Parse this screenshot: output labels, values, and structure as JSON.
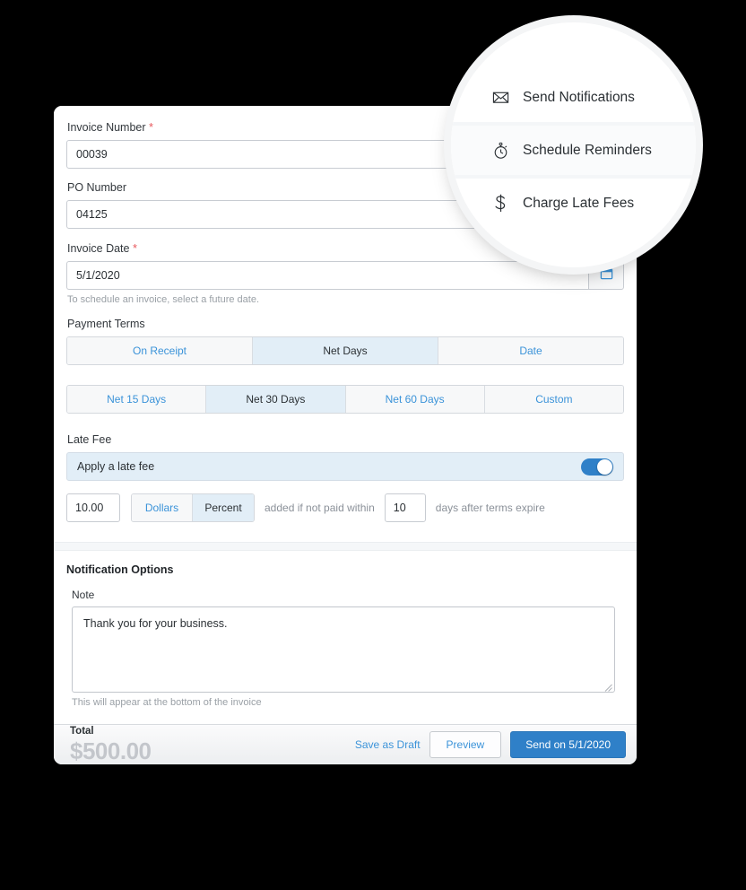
{
  "form": {
    "invoice_number": {
      "label": "Invoice Number",
      "required": "*",
      "value": "00039"
    },
    "po_number": {
      "label": "PO Number",
      "required": "",
      "value": "04125"
    },
    "invoice_date": {
      "label": "Invoice Date",
      "required": "*",
      "value": "5/1/2020",
      "help": "To schedule an invoice, select a future date.",
      "calendar_icon": "calendar-icon"
    },
    "payment_terms": {
      "label": "Payment Terms",
      "options": [
        "On Receipt",
        "Net Days",
        "Date"
      ],
      "selected": "Net Days"
    },
    "net_days": {
      "options": [
        "Net 15 Days",
        "Net 30 Days",
        "Net 60 Days",
        "Custom"
      ],
      "selected": "Net 30 Days"
    },
    "late_fee": {
      "label": "Late Fee",
      "toggle_label": "Apply a late fee",
      "toggle_on": true,
      "amount": "10.00",
      "unit_options": [
        "Dollars",
        "Percent"
      ],
      "unit_selected": "Percent",
      "mid_text": "added if not paid within",
      "days": "10",
      "tail_text": "days after terms expire"
    }
  },
  "notification_options": {
    "title": "Notification Options",
    "note_label": "Note",
    "note_value": "Thank you for your business.",
    "note_help": "This will appear at the bottom of the invoice"
  },
  "footer": {
    "total_label": "Total",
    "total_value": "$500.00",
    "save_draft": "Save as Draft",
    "preview": "Preview",
    "send": "Send on 5/1/2020"
  },
  "lens_menu": {
    "items": [
      {
        "label": "Send Notifications",
        "icon": "envelope-icon",
        "hover": false
      },
      {
        "label": "Schedule Reminders",
        "icon": "stopwatch-icon",
        "hover": true
      },
      {
        "label": "Charge Late Fees",
        "icon": "dollar-sign-icon",
        "hover": false
      }
    ]
  },
  "colors": {
    "accent_blue": "#2f80c8",
    "link_blue": "#3b93d9",
    "selected_tab": "#e2eef7",
    "required_red": "#e8595e",
    "page_background": "#000000"
  }
}
